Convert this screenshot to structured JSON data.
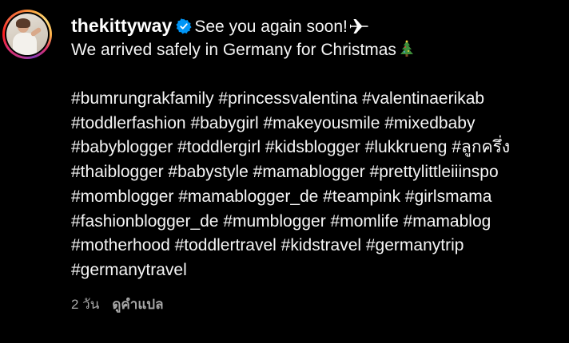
{
  "post": {
    "username": "thekittyway",
    "verified_icon": "verified-badge-icon",
    "first_line_text": "See you again soon!",
    "first_line_emoji": "airplane-icon",
    "second_line_text": "We arrived safely in Germany for Christmas",
    "second_line_emoji": "christmas-tree-icon",
    "hashtag_lines": [
      "#bumrungrakfamily #princessvalentina #valentinaerikab",
      "#toddlerfashion #babygirl #makeyousmile #mixedbaby",
      "#babyblogger #toddlergirl #kidsblogger #lukkrueng #ลูกครึ่ง",
      "#thaiblogger #babystyle #mamablogger #prettylittleiiinspo",
      "#momblogger #mamablogger_de #teampink #girlsmama",
      "#fashionblogger_de #mumblogger #momlife #mamablog",
      "#motherhood #toddlertravel #kidstravel #germanytrip",
      "#germanytravel"
    ],
    "timestamp": "2 วัน",
    "translate_label": "ดูคำแปล"
  },
  "colors": {
    "background": "#000000",
    "text": "#f5f5f5",
    "meta": "#a8a8a8",
    "verified": "#0095f6"
  }
}
